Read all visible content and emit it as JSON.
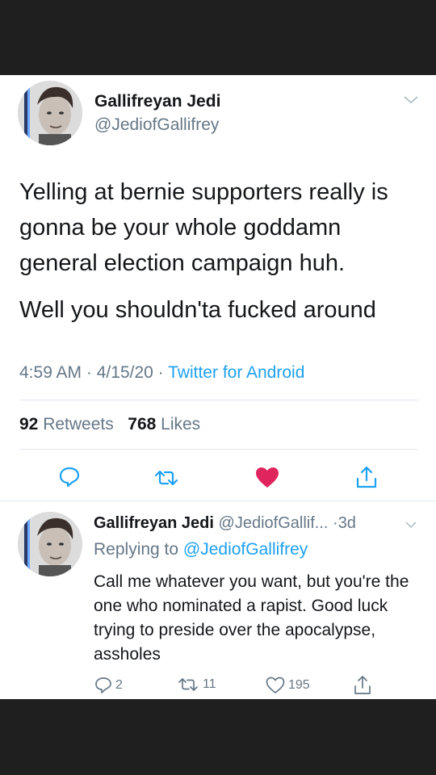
{
  "tweet": {
    "display_name": "Gallifreyan Jedi",
    "handle": "@JediofGallifrey",
    "text_lines": [
      "Yelling at bernie supporters really is gonna be your whole goddamn general election campaign huh.",
      "Well you shouldn'ta fucked around"
    ],
    "time": "4:59 AM",
    "date": "4/15/20",
    "separator": "·",
    "source": "Twitter for Android",
    "retweets_count": "92",
    "retweets_label": "Retweets",
    "likes_count": "768",
    "likes_label": "Likes",
    "liked": true,
    "colors": {
      "accent": "#1da1f2",
      "like": "#e0245e",
      "muted": "#657786",
      "text": "#14171a"
    }
  },
  "reply": {
    "display_name": "Gallifreyan Jedi",
    "handle": "@JediofGallif...",
    "separator": "·",
    "age": "3d",
    "replying_prefix": "Replying to",
    "replying_to": "@JediofGallifrey",
    "text": "Call me whatever you want,  but you're the one who nominated a rapist. Good luck trying to preside over the apocalypse, assholes",
    "reply_count": "2",
    "retweet_count": "11",
    "like_count": "195"
  },
  "icons": {
    "reply": "reply-bubble-icon",
    "retweet": "retweet-icon",
    "like": "heart-icon",
    "share": "share-icon",
    "menu": "chevron-down-icon"
  }
}
